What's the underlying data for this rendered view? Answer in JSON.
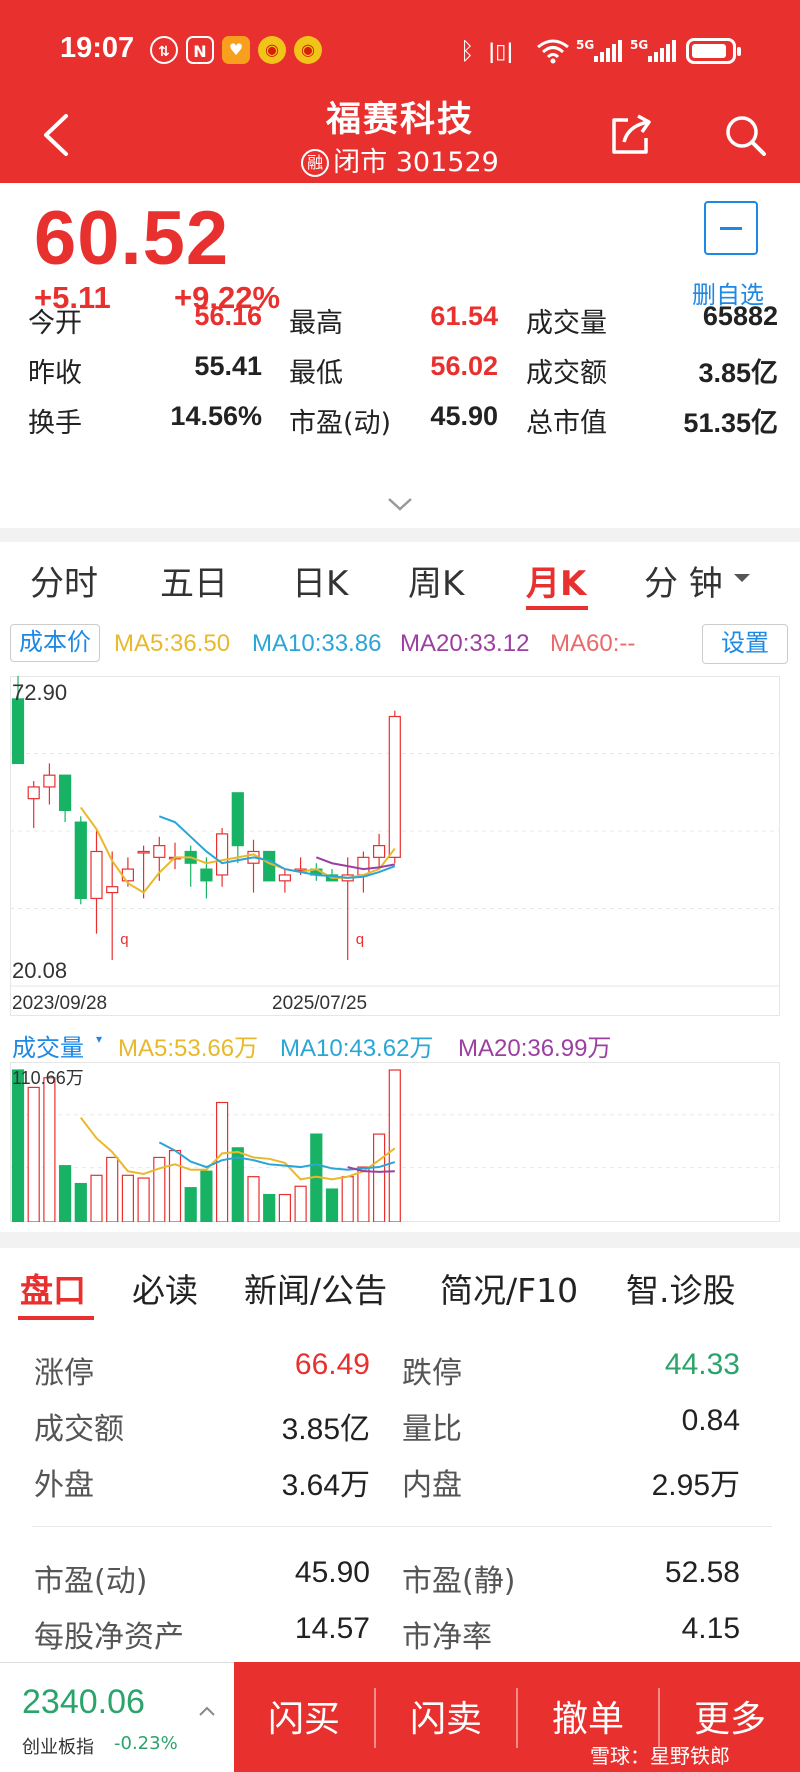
{
  "status_bar": {
    "time": "19:07",
    "icons": [
      "data-saver-icon",
      "nfc-icon",
      "app-badge-icon",
      "weibo-icon",
      "weibo-icon",
      "bluetooth-icon",
      "vibrate-icon",
      "wifi-icon",
      "signal-5g-icon",
      "signal-5g-icon",
      "battery-icon"
    ],
    "network_1": "5G",
    "network_2": "5G",
    "battery_level": 0.9
  },
  "header": {
    "title": "福赛科技",
    "margin_badge": "融",
    "subtitle": "闭市 301529"
  },
  "quote": {
    "price": "60.52",
    "change": "+5.11",
    "change_pct": "+9.22%",
    "watch_label": "删自选",
    "stats": [
      {
        "label": "今开",
        "value": "56.16",
        "color": "red"
      },
      {
        "label": "最高",
        "value": "61.54",
        "color": "red"
      },
      {
        "label": "成交量",
        "value": "65882",
        "color": "dark"
      },
      {
        "label": "昨收",
        "value": "55.41",
        "color": "dark"
      },
      {
        "label": "最低",
        "value": "56.02",
        "color": "red"
      },
      {
        "label": "成交额",
        "value": "3.85亿",
        "color": "dark"
      },
      {
        "label": "换手",
        "value": "14.56%",
        "color": "dark"
      },
      {
        "label": "市盈(动)",
        "value": "45.90",
        "color": "dark"
      },
      {
        "label": "总市值",
        "value": "51.35亿",
        "color": "dark"
      }
    ]
  },
  "chart_tabs": [
    "分时",
    "五日",
    "日K",
    "周K",
    "月K",
    "分 钟"
  ],
  "chart_tabs_active": 4,
  "ma_bar": {
    "cost_btn": "成本价",
    "ma5": "MA5:36.50",
    "ma10": "MA10:33.86",
    "ma20": "MA20:33.12",
    "ma60": "MA60:--",
    "settings_btn": "设置",
    "colors": {
      "ma5": "#e8b92a",
      "ma10": "#2aa6d6",
      "ma20": "#9c3fa1",
      "ma60": "#e86a6a"
    }
  },
  "chart_data": {
    "type": "candlestick",
    "price_max_label": "72.90",
    "price_min_label": "20.08",
    "ylim": [
      20.08,
      72.9
    ],
    "start_date_label": "2023/09/28",
    "end_date_label": "2025/07/25",
    "candles": [
      [
        69.0,
        72.9,
        58.0,
        58.0
      ],
      [
        52.0,
        55.0,
        47.0,
        54.0
      ],
      [
        54.0,
        58.0,
        51.0,
        56.0
      ],
      [
        56.0,
        56.0,
        48.0,
        50.0
      ],
      [
        48.0,
        49.0,
        34.0,
        35.0
      ],
      [
        35.0,
        47.0,
        29.0,
        43.0
      ],
      [
        36.0,
        43.0,
        24.5,
        37.0
      ],
      [
        38.0,
        42.0,
        37.0,
        40.0
      ],
      [
        43.0,
        44.0,
        35.0,
        43.0
      ],
      [
        42.0,
        45.5,
        38.0,
        44.0
      ],
      [
        42.0,
        44.5,
        40.0,
        42.0
      ],
      [
        43.0,
        44.0,
        37.0,
        41.0
      ],
      [
        40.0,
        42.0,
        35.0,
        38.0
      ],
      [
        39.0,
        47.0,
        37.0,
        46.0
      ],
      [
        53.0,
        53.0,
        41.0,
        44.0
      ],
      [
        41.0,
        45.0,
        36.0,
        43.0
      ],
      [
        43.0,
        43.0,
        38.0,
        38.0
      ],
      [
        38.0,
        40.0,
        36.0,
        39.0
      ],
      [
        40.0,
        42.0,
        39.0,
        40.0
      ],
      [
        40.0,
        41.0,
        38.0,
        39.0
      ],
      [
        39.0,
        40.0,
        38.0,
        38.0
      ],
      [
        38.0,
        42.0,
        24.5,
        39.0
      ],
      [
        39.0,
        43.0,
        36.0,
        42.0
      ],
      [
        42.0,
        46.0,
        40.0,
        44.0
      ],
      [
        42.0,
        67.0,
        41.0,
        66.0
      ]
    ],
    "ma5_line": [
      null,
      null,
      null,
      null,
      50.5,
      46.8,
      41.4,
      37.6,
      36.0,
      39.4,
      42.0,
      42.0,
      41.0,
      41.5,
      42.0,
      42.5,
      41.0,
      40.0,
      39.5,
      40.0,
      38.5,
      38.5,
      39.0,
      40.0,
      43.5
    ],
    "ma10_line": [
      null,
      null,
      null,
      null,
      null,
      null,
      null,
      null,
      null,
      49.0,
      48.0,
      45.5,
      43.0,
      41.0,
      41.5,
      42.0,
      41.5,
      40.0,
      39.5,
      39.0,
      38.8,
      38.5,
      38.7,
      39.5,
      40.5
    ],
    "ma20_line": [
      null,
      null,
      null,
      null,
      null,
      null,
      null,
      null,
      null,
      null,
      null,
      null,
      null,
      null,
      null,
      null,
      null,
      null,
      null,
      42.0,
      41.0,
      40.5,
      40.0,
      40.3,
      40.8
    ],
    "low_markers": [
      {
        "index": 6,
        "label": "q"
      },
      {
        "index": 21,
        "label": "q"
      }
    ]
  },
  "volume_bar": {
    "title": "成交量",
    "ma5": "MA5:53.66万",
    "ma10": "MA10:43.62万",
    "ma20": "MA20:36.99万",
    "max_label": "110.66万",
    "volumes_wan": [
      110.66,
      98.0,
      105.0,
      41.0,
      28.0,
      34.0,
      47.0,
      34.0,
      32.0,
      47.0,
      52.0,
      25.0,
      37.0,
      87.0,
      54.0,
      33.0,
      20.0,
      20.0,
      26.0,
      64.0,
      24.0,
      33.0,
      40.0,
      64.0,
      110.66
    ],
    "ma5_line": [
      null,
      null,
      null,
      null,
      76.0,
      61.0,
      51.0,
      37.0,
      35.0,
      39.0,
      42.0,
      38.0,
      38.0,
      50.0,
      51.0,
      47.0,
      46.0,
      43.0,
      31.0,
      33.0,
      31.0,
      33.0,
      37.0,
      45.0,
      53.66
    ],
    "ma10_line": [
      null,
      null,
      null,
      null,
      null,
      null,
      null,
      null,
      null,
      58.0,
      52.0,
      44.0,
      40.0,
      45.0,
      47.0,
      45.0,
      42.0,
      41.0,
      40.0,
      42.0,
      39.0,
      38.0,
      39.0,
      40.0,
      43.62
    ],
    "ma20_line": [
      null,
      null,
      null,
      null,
      null,
      null,
      null,
      null,
      null,
      null,
      null,
      null,
      null,
      null,
      null,
      null,
      null,
      null,
      null,
      null,
      null,
      40.0,
      37.0,
      36.5,
      36.99
    ]
  },
  "detail_tabs": [
    "盘口",
    "必读",
    "新闻/公告",
    "简况/F10",
    "智.诊股"
  ],
  "detail_tabs_active": 0,
  "panel": {
    "rows": [
      {
        "l1": "涨停",
        "v1": "66.49",
        "c1": "red",
        "l2": "跌停",
        "v2": "44.33",
        "c2": "green"
      },
      {
        "l1": "成交额",
        "v1": "3.85亿",
        "c1": "dark",
        "l2": "量比",
        "v2": "0.84",
        "c2": "dark"
      },
      {
        "l1": "外盘",
        "v1": "3.64万",
        "c1": "dark",
        "l2": "内盘",
        "v2": "2.95万",
        "c2": "dark"
      },
      {
        "l1": "市盈(动)",
        "v1": "45.90",
        "c1": "dark",
        "l2": "市盈(静)",
        "v2": "52.58",
        "c2": "dark"
      },
      {
        "l1": "每股净资产",
        "v1": "14.57",
        "c1": "dark",
        "l2": "市净率",
        "v2": "4.15",
        "c2": "dark"
      }
    ]
  },
  "bottom": {
    "index_value": "2340.06",
    "index_name": "创业板指",
    "index_change": "-0.23%",
    "actions": [
      "闪买",
      "闪卖",
      "撤单",
      "更多"
    ],
    "watermark": "雪球：星野铁郎"
  },
  "colors": {
    "red": "#e8302f",
    "green": "#2aa46a",
    "blue": "#1e88e5"
  }
}
